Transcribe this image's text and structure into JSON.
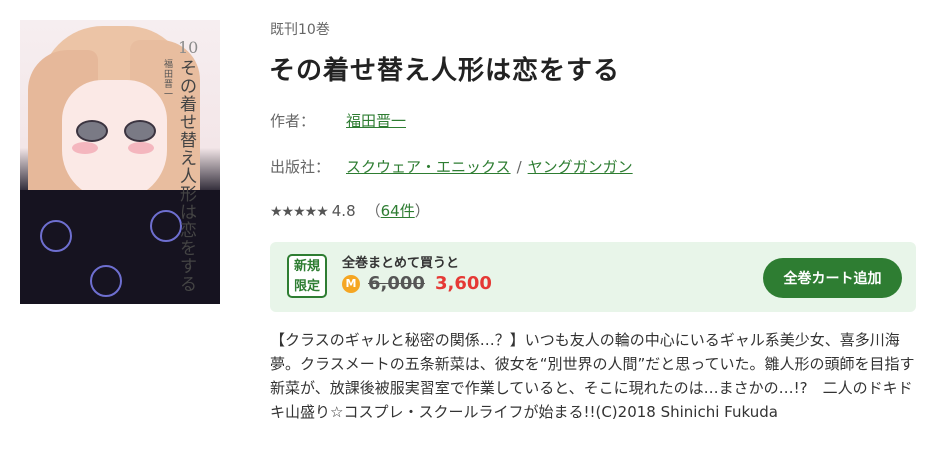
{
  "book": {
    "volume_count": "既刊10巻",
    "title": "その着せ替え人形は恋をする",
    "cover": {
      "volume_number": "10",
      "vertical_title": "その着せ替え人形は恋をする",
      "vertical_author": "福田晋一"
    }
  },
  "meta": {
    "author_label": "作者：",
    "author": "福田晋一",
    "publisher_label": "出版社：",
    "publisher": "スクウェア・エニックス",
    "separator": "/",
    "label": "ヤングガンガン"
  },
  "rating": {
    "stars": "★★★★★",
    "score": "4.8",
    "count_open": "（",
    "count": "64件",
    "count_close": "）",
    "star_value": 4.8
  },
  "purchase": {
    "badge_line1": "新規",
    "badge_line2": "限定",
    "label": "全巻まとめて買うと",
    "coin_symbol": "M",
    "old_price": "6,000",
    "new_price": "3,600",
    "cart_button": "全巻カート追加",
    "accent_color": "#2e7d32",
    "sale_color": "#e53935"
  },
  "description": "【クラスのギャルと秘密の関係…？】いつも友人の輪の中心にいるギャル系美少女、喜多川海夢。クラスメートの五条新菜は、彼女を“別世界の人間”だと思っていた。雛人形の頭師を目指す新菜が、放課後被服実習室で作業していると、そこに現れたのは…まさかの…!?　二人のドキドキ山盛り☆コスプレ・スクールライフが始まる!!(C)2018 Shinichi Fukuda"
}
